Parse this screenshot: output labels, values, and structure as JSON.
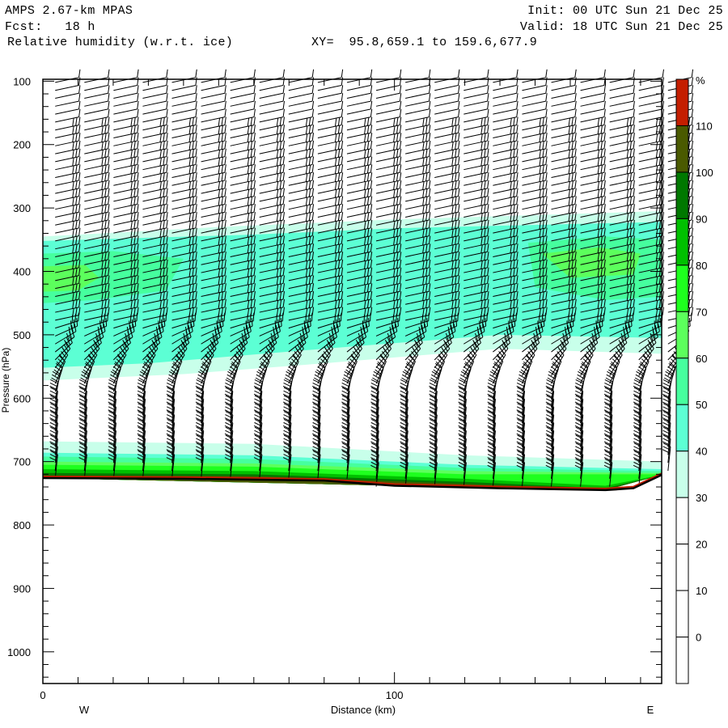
{
  "header": {
    "model": "AMPS 2.67-km MPAS",
    "forecast": "Fcst:   18 h",
    "field": "Relative humidity (w.r.t. ice)",
    "xy": "XY=  95.8,659.1 to 159.6,677.9",
    "init": "Init: 00 UTC Sun 21 Dec 25",
    "valid": "Valid: 18 UTC Sun 21 Dec 25"
  },
  "chart_data": {
    "type": "heatmap",
    "title": "Relative humidity (w.r.t. ice)",
    "xlabel": "Distance (km)",
    "ylabel": "Pressure (hPa)",
    "xlim": [
      0,
      176
    ],
    "ylim": [
      1050,
      97
    ],
    "x_ticks": [
      {
        "value": 0,
        "label": "0"
      },
      {
        "value": 100,
        "label": "100"
      }
    ],
    "x_minor_step": 10,
    "y_ticks": [
      {
        "value": 100,
        "label": "100"
      },
      {
        "value": 200,
        "label": "200"
      },
      {
        "value": 300,
        "label": "300"
      },
      {
        "value": 400,
        "label": "400"
      },
      {
        "value": 500,
        "label": "500"
      },
      {
        "value": 600,
        "label": "600"
      },
      {
        "value": 700,
        "label": "700"
      },
      {
        "value": 800,
        "label": "800"
      },
      {
        "value": 900,
        "label": "900"
      },
      {
        "value": 1000,
        "label": "1000"
      }
    ],
    "y_minor_step": 20,
    "direction_labels": {
      "left": "W",
      "right": "E"
    },
    "colorbar": {
      "unit": "%",
      "labels": [
        "110",
        "100",
        "90",
        "80",
        "70",
        "60",
        "50",
        "40",
        "30",
        "20",
        "10",
        "0"
      ],
      "colors": [
        "#c41e00",
        "#4a5a00",
        "#007800",
        "#00c000",
        "#1eff1e",
        "#5cff5c",
        "#46ff9e",
        "#5cffd4",
        "#c8ffea",
        "#ffffff",
        "#ffffff",
        "#ffffff",
        "#ffffff"
      ]
    },
    "rh_bands": [
      {
        "min": 30,
        "color": "#c8ffea",
        "polygon": [
          [
            0,
            345
          ],
          [
            50,
            330
          ],
          [
            100,
            318
          ],
          [
            176,
            305
          ],
          [
            176,
            530
          ],
          [
            130,
            522
          ],
          [
            80,
            545
          ],
          [
            40,
            562
          ],
          [
            0,
            572
          ]
        ]
      },
      {
        "min": 40,
        "color": "#5cffd4",
        "polygon": [
          [
            0,
            352
          ],
          [
            60,
            342
          ],
          [
            100,
            332
          ],
          [
            176,
            322
          ],
          [
            176,
            505
          ],
          [
            130,
            500
          ],
          [
            80,
            522
          ],
          [
            30,
            545
          ],
          [
            0,
            552
          ]
        ]
      },
      {
        "min": 50,
        "color": "#46ff9e",
        "polygon": [
          [
            0,
            372
          ],
          [
            20,
            368
          ],
          [
            40,
            380
          ],
          [
            35,
            430
          ],
          [
            15,
            445
          ],
          [
            0,
            450
          ]
        ]
      },
      {
        "min": 50,
        "color": "#46ff9e",
        "polygon": [
          [
            138,
            355
          ],
          [
            160,
            345
          ],
          [
            176,
            350
          ],
          [
            176,
            440
          ],
          [
            160,
            445
          ],
          [
            140,
            425
          ]
        ]
      },
      {
        "min": 60,
        "color": "#5cff5c",
        "polygon": [
          [
            0,
            392
          ],
          [
            12,
            390
          ],
          [
            16,
            410
          ],
          [
            10,
            430
          ],
          [
            0,
            432
          ]
        ]
      },
      {
        "min": 60,
        "color": "#5cff5c",
        "polygon": [
          [
            142,
            372
          ],
          [
            158,
            362
          ],
          [
            170,
            372
          ],
          [
            168,
            405
          ],
          [
            150,
            410
          ]
        ]
      },
      {
        "min": 30,
        "color": "#c8ffea",
        "polygon": [
          [
            0,
            668
          ],
          [
            60,
            672
          ],
          [
            120,
            690
          ],
          [
            176,
            700
          ],
          [
            176,
            721
          ],
          [
            160,
            745
          ],
          [
            100,
            738
          ],
          [
            0,
            726
          ]
        ]
      },
      {
        "min": 40,
        "color": "#5cffd4",
        "polygon": [
          [
            0,
            686
          ],
          [
            60,
            690
          ],
          [
            120,
            705
          ],
          [
            176,
            712
          ],
          [
            176,
            721
          ],
          [
            160,
            745
          ],
          [
            100,
            738
          ],
          [
            0,
            726
          ]
        ]
      },
      {
        "min": 50,
        "color": "#46ff9e",
        "polygon": [
          [
            0,
            692
          ],
          [
            60,
            696
          ],
          [
            120,
            710
          ],
          [
            176,
            715
          ],
          [
            176,
            721
          ],
          [
            160,
            745
          ],
          [
            100,
            738
          ],
          [
            0,
            726
          ]
        ]
      },
      {
        "min": 60,
        "color": "#5cff5c",
        "polygon": [
          [
            0,
            700
          ],
          [
            60,
            703
          ],
          [
            120,
            715
          ],
          [
            176,
            718
          ],
          [
            176,
            721
          ],
          [
            160,
            745
          ],
          [
            100,
            738
          ],
          [
            0,
            726
          ]
        ]
      },
      {
        "min": 70,
        "color": "#1eff1e",
        "polygon": [
          [
            0,
            705
          ],
          [
            60,
            708
          ],
          [
            120,
            720
          ],
          [
            176,
            720
          ],
          [
            176,
            721
          ],
          [
            160,
            745
          ],
          [
            100,
            738
          ],
          [
            0,
            726
          ]
        ]
      },
      {
        "min": 80,
        "color": "#00c000",
        "polygon": [
          [
            0,
            712
          ],
          [
            60,
            715
          ],
          [
            120,
            727
          ],
          [
            160,
            738
          ],
          [
            176,
            721
          ],
          [
            160,
            745
          ],
          [
            100,
            738
          ],
          [
            0,
            726
          ]
        ]
      },
      {
        "min": 90,
        "color": "#007800",
        "polygon": [
          [
            0,
            718
          ],
          [
            60,
            720
          ],
          [
            120,
            732
          ],
          [
            160,
            742
          ],
          [
            176,
            721
          ],
          [
            160,
            745
          ],
          [
            100,
            738
          ],
          [
            0,
            726
          ]
        ]
      },
      {
        "min": 100,
        "color": "#4a5a00",
        "polygon": [
          [
            0,
            722
          ],
          [
            60,
            723
          ],
          [
            120,
            735
          ],
          [
            160,
            744
          ],
          [
            176,
            721
          ],
          [
            160,
            745
          ],
          [
            100,
            738
          ],
          [
            0,
            726
          ]
        ]
      }
    ],
    "surface_pressure": [
      [
        0,
        726
      ],
      [
        40,
        727
      ],
      [
        80,
        730
      ],
      [
        100,
        738
      ],
      [
        130,
        742
      ],
      [
        160,
        745
      ],
      [
        168,
        742
      ],
      [
        176,
        721
      ]
    ],
    "wind_barbs": {
      "columns_km_start": 3.5,
      "columns_km_step": 8.3,
      "column_count": 22,
      "level_step_hPa": 12.5
    }
  }
}
